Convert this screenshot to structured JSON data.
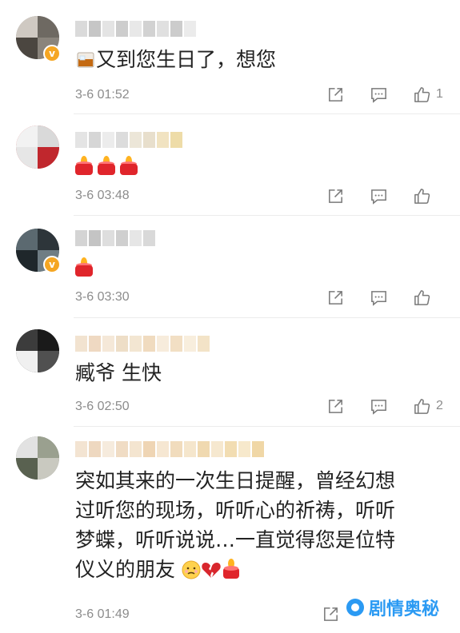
{
  "comments": [
    {
      "text": "又到您生日了，想您",
      "leading_emoji": "whisky-glass",
      "time": "3-6 01:52",
      "likes": "1",
      "verified": true
    },
    {
      "text": "",
      "emojis": [
        "candle",
        "candle",
        "candle"
      ],
      "time": "3-6 03:48",
      "likes": "",
      "verified": false
    },
    {
      "text": "",
      "emojis": [
        "candle"
      ],
      "time": "3-6 03:30",
      "likes": "",
      "verified": true
    },
    {
      "text": "臧爷 生快",
      "time": "3-6 02:50",
      "likes": "2",
      "verified": false
    },
    {
      "lines": [
        "突如其来的一次生日提醒，曾经幻想",
        "过听您的现场，听听心的祈祷，听听",
        "梦蝶，听听说说…一直觉得您是位特",
        "仪义的朋友"
      ],
      "trailing_emojis": [
        "sad-face",
        "broken-heart",
        "candle"
      ],
      "time": "3-6 01:49",
      "likes": "",
      "verified": false
    }
  ],
  "icons": {
    "share": "share-icon",
    "reply": "comment-icon",
    "like": "thumbs-up-icon"
  },
  "watermark": {
    "text": "剧情奥秘"
  },
  "colors": {
    "text": "#222222",
    "meta": "#8c8c8c",
    "verified": "#f5a623",
    "candle": "#e0252b",
    "watermark": "#2b9af3"
  }
}
